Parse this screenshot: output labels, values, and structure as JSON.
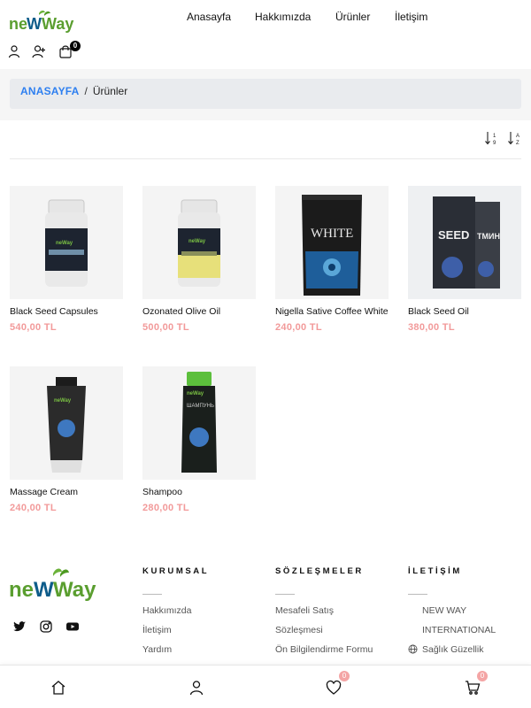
{
  "brand": {
    "logo_text": "neWWay",
    "colors": {
      "green": "#5a9e2f",
      "dark_green": "#3d7a1a",
      "blue": "#0e5c8a"
    }
  },
  "nav": {
    "items": [
      "Anasayfa",
      "Hakkımızda",
      "Ürünler",
      "İletişim"
    ]
  },
  "header_icons": {
    "cart_count": "0",
    "icons": [
      "user-icon",
      "user-add-icon",
      "shopping-bag-icon"
    ]
  },
  "breadcrumb": {
    "home": "ANASAYFA",
    "separator": "/",
    "current": "Ürünler"
  },
  "sort": {
    "icons": [
      "sort-numeric-icon",
      "sort-alpha-icon"
    ]
  },
  "products": [
    {
      "name": "Black Seed Capsules",
      "price": "540,00 TL"
    },
    {
      "name": "Ozonated Olive Oil",
      "price": "500,00 TL"
    },
    {
      "name": "Nigella Sative Coffee White",
      "price": "240,00 TL"
    },
    {
      "name": "Black Seed Oil",
      "price": "380,00 TL"
    },
    {
      "name": "Massage Cream",
      "price": "240,00 TL"
    },
    {
      "name": "Shampoo",
      "price": "280,00 TL"
    }
  ],
  "footer": {
    "social": [
      "twitter-icon",
      "instagram-icon",
      "youtube-icon"
    ],
    "columns": [
      {
        "title": "KURUMSAL",
        "links": [
          "Hakkımızda",
          "İletişim",
          "Yardım"
        ]
      },
      {
        "title": "SÖZLEŞMELER",
        "links": [
          "Mesafeli Satış",
          "Sözleşmesi",
          "Ön Bilgilendirme Formu"
        ]
      },
      {
        "title": "İLETİŞİM",
        "links": [
          "NEW WAY",
          "INTERNATIONAL",
          "Sağlık Güzellik"
        ]
      }
    ]
  },
  "bottom_bar": {
    "wishlist_count": "0",
    "cart_count": "0",
    "icons": [
      "home-icon",
      "account-icon",
      "heart-icon",
      "cart-icon"
    ]
  },
  "accent_colors": {
    "link_blue": "#2d7ff0",
    "price_pink": "#f29a9a",
    "badge_pink": "#f4a5a5"
  }
}
